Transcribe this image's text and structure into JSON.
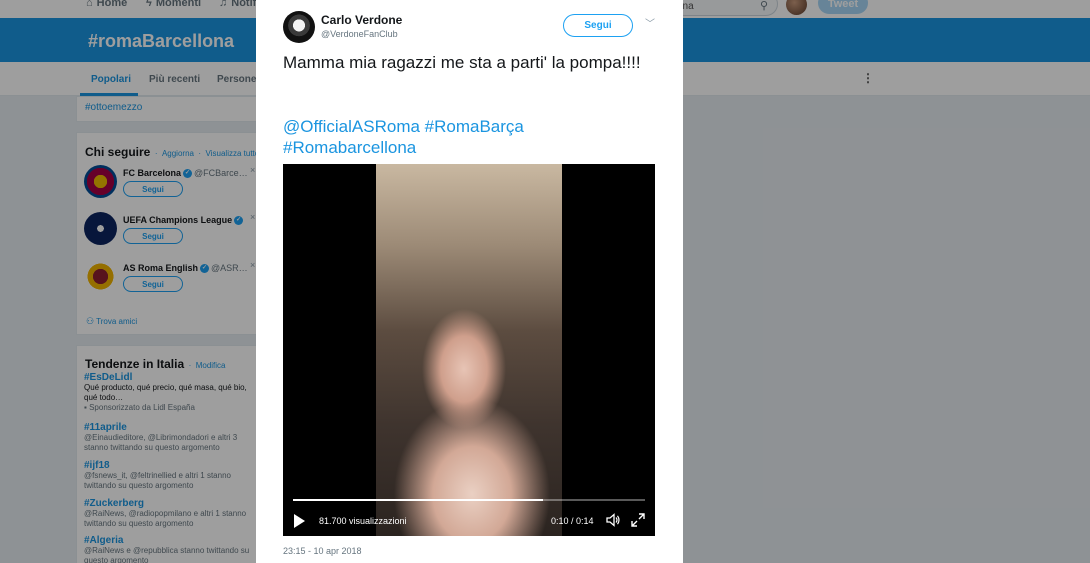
{
  "topnav": {
    "home": "Home",
    "moments": "Momenti",
    "notifications": "Notif",
    "search_value": "ona",
    "tweet": "Tweet"
  },
  "hero": {
    "hashtag": "#romaBarcellona"
  },
  "tabs": [
    "Popolari",
    "Più recenti",
    "Persone"
  ],
  "hashtag_card": {
    "tag": "#ottoemezzo"
  },
  "who_to_follow": {
    "title": "Chi seguire",
    "refresh": "Aggiorna",
    "view_all": "Visualizza tutto",
    "follow_label": "Segui",
    "accounts": [
      {
        "name": "FC Barcelona",
        "handle": "@FCBarce…",
        "avatar_color": "#a50044"
      },
      {
        "name": "UEFA Champions League",
        "handle": "",
        "avatar_color": "#0c2460"
      },
      {
        "name": "AS Roma English",
        "handle": "@ASR…",
        "avatar_color": "#f0b400"
      }
    ],
    "find_friends": "Trova amici"
  },
  "trends": {
    "title": "Tendenze in Italia",
    "change": "Modifica",
    "items": [
      {
        "tag": "#EsDeLidl",
        "desc": "Qué producto, qué precio, qué masa, qué bio, qué todo…",
        "meta": "Sponsorizzato da Lidl España"
      },
      {
        "tag": "#11aprile",
        "desc": "@Einaudieditore, @Librimondadori e altri 3 stanno twittando su questo argomento"
      },
      {
        "tag": "#ijf18",
        "desc": "@fsnews_it, @feltrinellied e altri 1 stanno twittando su questo argomento"
      },
      {
        "tag": "#Zuckerberg",
        "desc": "@RaiNews, @radiopopmilano e altri 1 stanno twittando su questo argomento"
      },
      {
        "tag": "#Algeria",
        "desc": "@RaiNews e @repubblica stanno twittando su questo argomento"
      }
    ]
  },
  "tweet": {
    "author": "Carlo Verdone",
    "handle": "@VerdoneFanClub",
    "follow_label": "Segui",
    "text": "Mamma mia ragazzi me sta a parti' la pompa!!!!",
    "links": "@OfficialASRoma #RomaBarça #Romabarcellona",
    "timestamp": "23:15 - 10 apr 2018"
  },
  "video": {
    "views": "81.700 visualizzazioni",
    "time": "0:10 / 0:14",
    "progress": 0.71
  },
  "colors": {
    "accent": "#1da1f2",
    "hero": "#1b95e0"
  }
}
